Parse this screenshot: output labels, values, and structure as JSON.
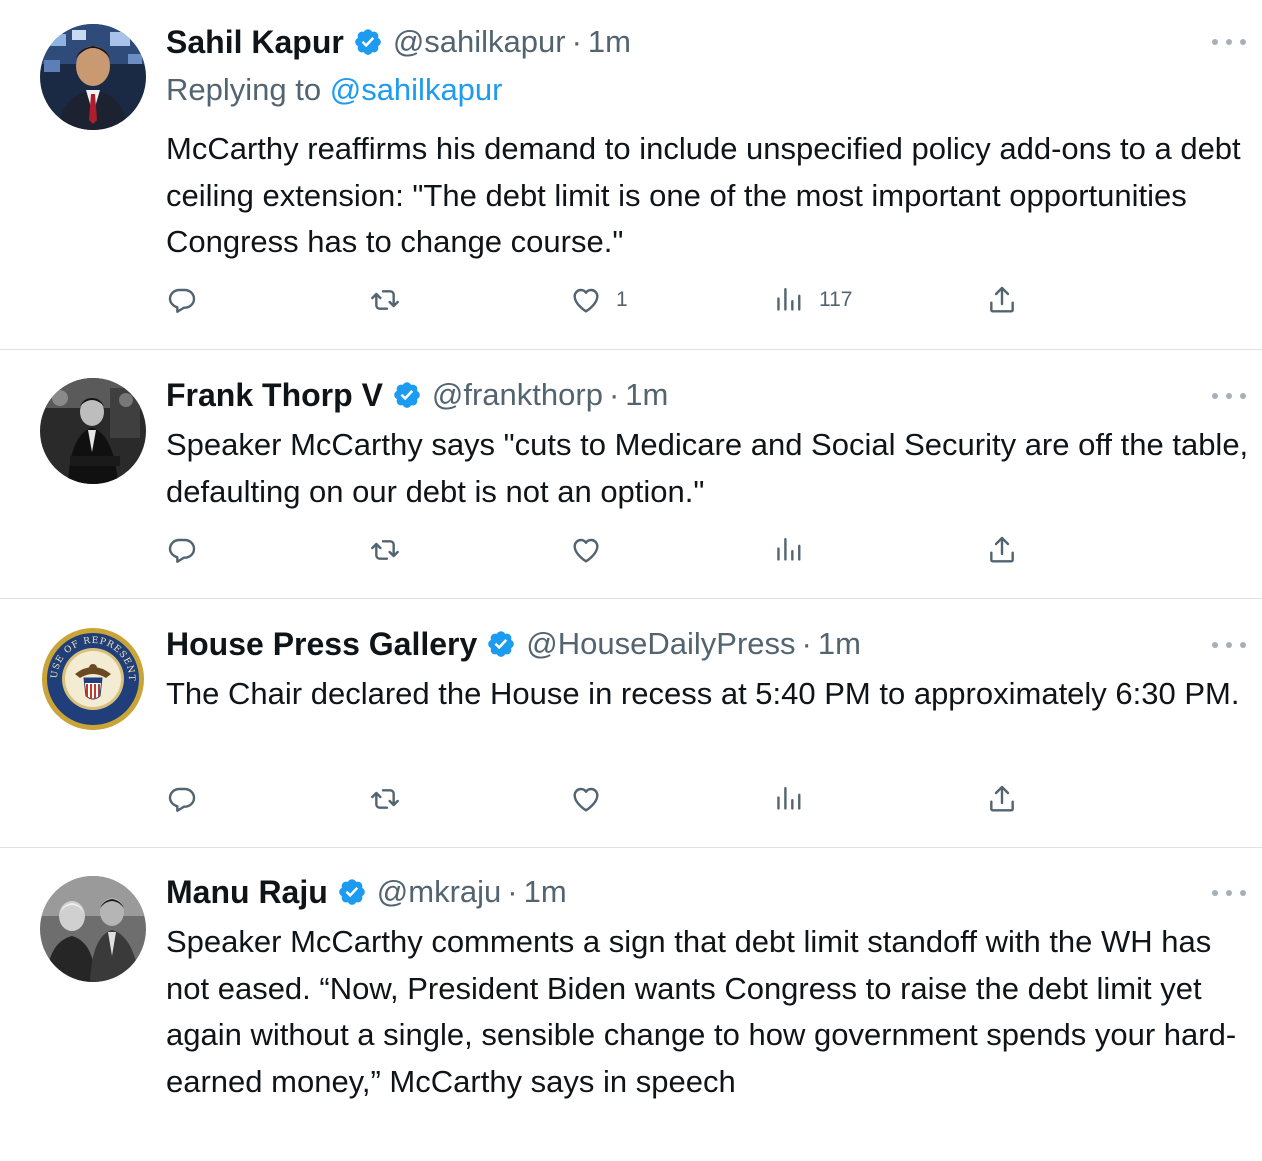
{
  "tweets": [
    {
      "name": "Sahil Kapur",
      "handle": "@sahilkapur",
      "time": "1m",
      "replying_label": "Replying to",
      "replying_handle": "@sahilkapur",
      "text": "McCarthy reaffirms his demand to include unspecified policy add-ons to a debt ceiling extension: \"The debt limit is one of the most important opportunities Congress has to change course.\"",
      "likes": "1",
      "views": "117"
    },
    {
      "name": "Frank Thorp V",
      "handle": "@frankthorp",
      "time": "1m",
      "text": "Speaker McCarthy says \"cuts to Medicare and Social Security are off the table, defaulting on our debt is not an option.\"",
      "likes": "",
      "views": ""
    },
    {
      "name": "House Press Gallery",
      "handle": "@HouseDailyPress",
      "time": "1m",
      "seal_text": "U.S. HOUSE OF REPRESENTATIVES",
      "text": "The Chair declared the House in recess at 5:40 PM to approximately 6:30 PM.",
      "likes": "",
      "views": ""
    },
    {
      "name": "Manu Raju",
      "handle": "@mkraju",
      "time": "1m",
      "text": "Speaker McCarthy comments a sign that debt limit standoff with the WH has not eased. “Now, President Biden wants Congress to raise the debt limit yet again without a single, sensible change to how government spends your hard-earned money,” McCarthy says in speech",
      "likes": "",
      "views": ""
    }
  ],
  "separator": "·",
  "colors": {
    "text": "#0f1419",
    "secondary": "#536471",
    "accent": "#1d9bf0",
    "divider": "#dfe3e6"
  },
  "icons": [
    "reply-icon",
    "retweet-icon",
    "like-icon",
    "views-icon",
    "share-icon",
    "more-icon",
    "verified-badge-icon"
  ]
}
